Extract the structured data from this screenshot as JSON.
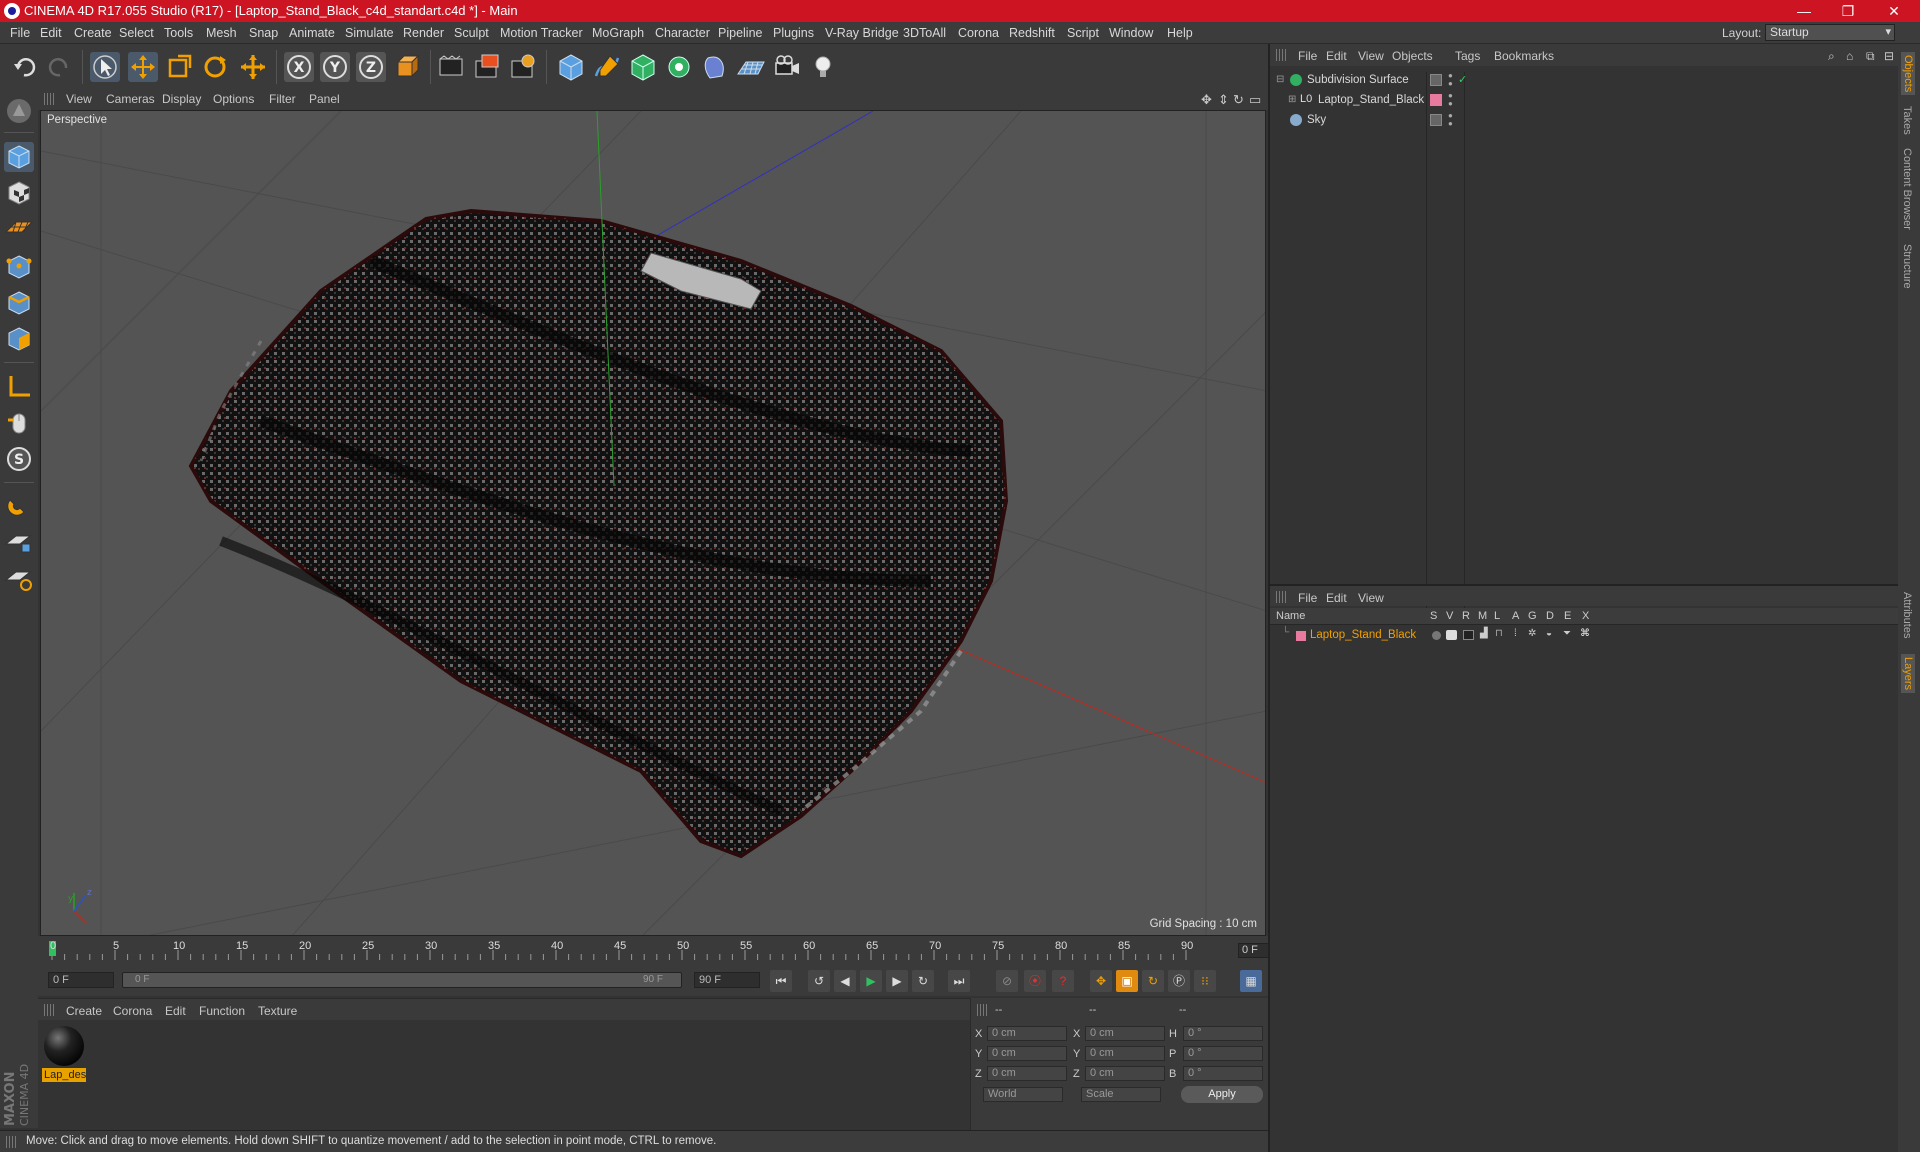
{
  "window": {
    "title": "CINEMA 4D R17.055 Studio (R17) - [Laptop_Stand_Black_c4d_standart.c4d *] - Main",
    "minimize": "—",
    "maximize": "❐",
    "close": "✕"
  },
  "menubar": {
    "items": [
      "File",
      "Edit",
      "Create",
      "Select",
      "Tools",
      "Mesh",
      "Snap",
      "Animate",
      "Simulate",
      "Render",
      "Sculpt",
      "Motion Tracker",
      "MoGraph",
      "Character",
      "Pipeline",
      "Plugins",
      "V-Ray Bridge",
      "3DToAll",
      "Corona",
      "Redshift",
      "Script",
      "Window",
      "Help"
    ],
    "layout_label": "Layout:",
    "layout_value": "Startup"
  },
  "toolbar": {
    "axis_x": "X",
    "axis_y": "Y",
    "axis_z": "Z"
  },
  "viewport": {
    "menu": [
      "View",
      "Cameras",
      "Display",
      "Options",
      "Filter",
      "Panel"
    ],
    "label": "Perspective",
    "grid_spacing": "Grid Spacing : 10 cm"
  },
  "timeline": {
    "ticks": [
      "0",
      "5",
      "10",
      "15",
      "20",
      "25",
      "30",
      "35",
      "40",
      "45",
      "50",
      "55",
      "60",
      "65",
      "70",
      "75",
      "80",
      "85",
      "90"
    ],
    "current_frame": "0 F",
    "start_field": "0 F",
    "range_start": "0 F",
    "range_end": "90 F",
    "end_field": "90 F"
  },
  "materials": {
    "menu": [
      "Create",
      "Corona",
      "Edit",
      "Function",
      "Texture"
    ],
    "items": [
      {
        "name": "Lap_des"
      }
    ]
  },
  "coordinates": {
    "header": [
      "--",
      "--",
      "--"
    ],
    "rows": [
      {
        "l1": "X",
        "v1": "0 cm",
        "l2": "X",
        "v2": "0 cm",
        "l3": "H",
        "v3": "0 °"
      },
      {
        "l1": "Y",
        "v1": "0 cm",
        "l2": "Y",
        "v2": "0 cm",
        "l3": "P",
        "v3": "0 °"
      },
      {
        "l1": "Z",
        "v1": "0 cm",
        "l2": "Z",
        "v2": "0 cm",
        "l3": "B",
        "v3": "0 °"
      }
    ],
    "mode": "World",
    "size_mode": "Scale",
    "apply": "Apply"
  },
  "status": "Move: Click and drag to move elements. Hold down SHIFT to quantize movement / add to the selection in point mode, CTRL to remove.",
  "objects_panel": {
    "menu": [
      "File",
      "Edit",
      "View",
      "Objects",
      "Tags",
      "Bookmarks"
    ],
    "items": [
      {
        "name": "Subdivision Surface"
      },
      {
        "name": "Laptop_Stand_Black"
      },
      {
        "name": "Sky"
      }
    ]
  },
  "layers_panel": {
    "menu": [
      "File",
      "Edit",
      "View"
    ],
    "headers": [
      "Name",
      "S",
      "V",
      "R",
      "M",
      "L",
      "A",
      "G",
      "D",
      "E",
      "X"
    ],
    "items": [
      {
        "name": "Laptop_Stand_Black",
        "color": "#e87aa0"
      }
    ]
  },
  "side_tabs": [
    "Objects",
    "Takes",
    "Content Browser",
    "Structure",
    "Attributes",
    "Layers"
  ],
  "brand": {
    "maxon": "MAXON",
    "product": "CINEMA 4D"
  },
  "colors": {
    "accent": "#e8a200",
    "titlebar": "#cc1423",
    "x_axis": "#c0281c",
    "y_axis": "#2aa02a",
    "z_axis": "#3030c0"
  }
}
